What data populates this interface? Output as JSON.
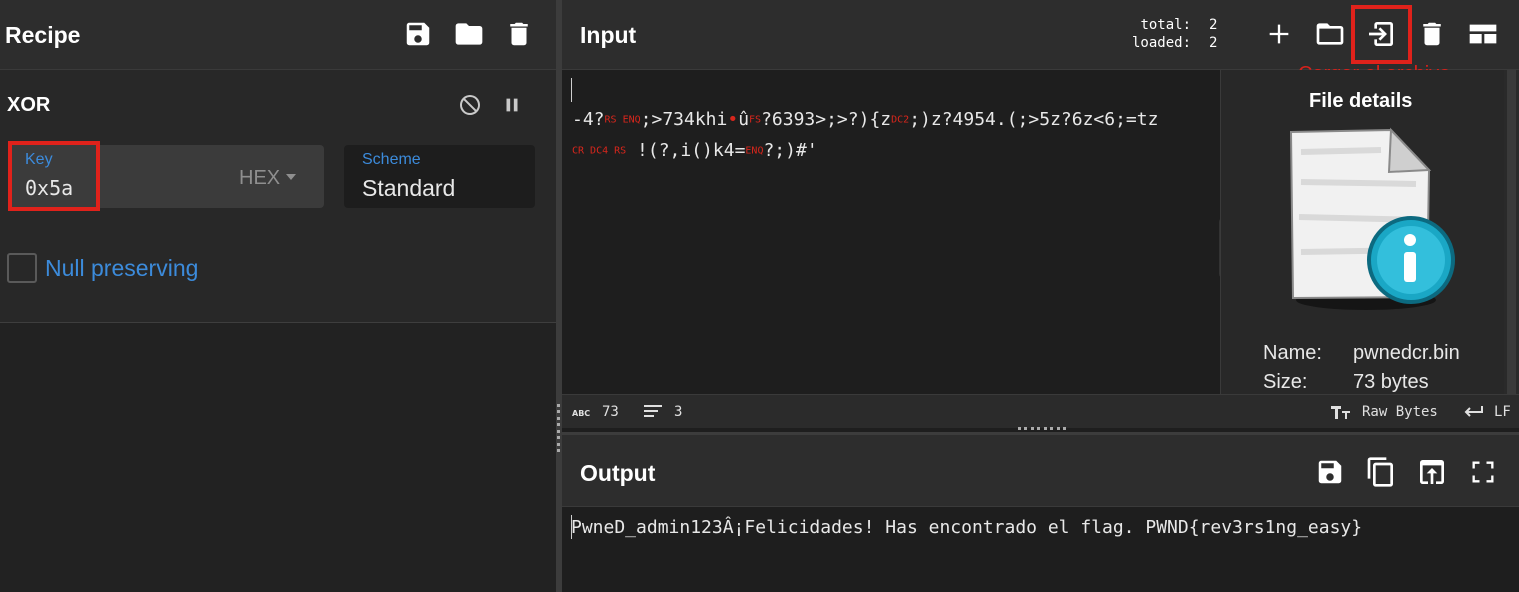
{
  "recipe": {
    "title": "Recipe",
    "operation": {
      "name": "XOR",
      "key": {
        "label": "Key",
        "value": "0x5a",
        "format": "HEX"
      },
      "scheme": {
        "label": "Scheme",
        "value": "Standard"
      },
      "null_preserving": {
        "label": "Null preserving",
        "checked": false
      }
    }
  },
  "input": {
    "title": "Input",
    "counts": {
      "total_label": "total:",
      "total": "2",
      "loaded_label": "loaded:",
      "loaded": "2"
    },
    "annotation": "Cargar el archivo",
    "lines": {
      "l1a": "-4?",
      "l1b": "RS ENQ",
      "l1c": ";>734khi",
      "l1d": "•",
      "l1e": "û",
      "l1f": "FS",
      "l1g": "?6393>;>?){z",
      "l1h": "DC2",
      "l1i": ";)z?4954.(;>5z?6z<6;=tz",
      "l2a": "CR DC4 RS",
      "l2b": "!(?,i()k4=",
      "l2c": "ENQ",
      "l2d": "?;)#'"
    },
    "file_details": {
      "title": "File details",
      "name_label": "Name:",
      "name": "pwnedcr.bin",
      "size_label": "Size:",
      "size": "73 bytes"
    },
    "status": {
      "chars": "73",
      "lines": "3",
      "encoding": "Raw Bytes",
      "eol": "LF"
    }
  },
  "output": {
    "title": "Output",
    "text": "PwneD_admin123Â¡Felicidades! Has encontrado el flag. PWND{rev3rs1ng_easy}"
  },
  "colors": {
    "accent_blue": "#3c8bdb",
    "highlight_red": "#e0221b",
    "control_char_red": "#d8261c"
  }
}
